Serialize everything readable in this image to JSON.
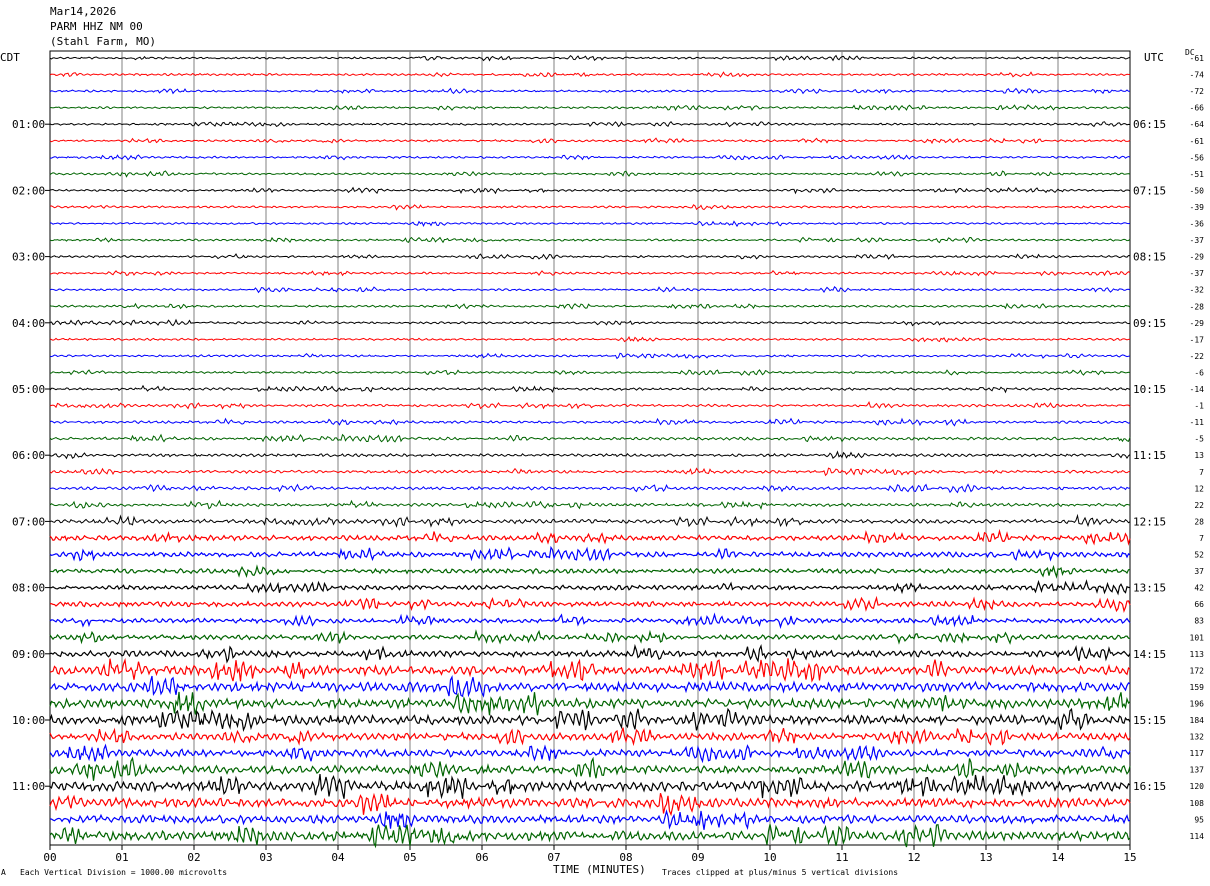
{
  "header": {
    "date": "Mar14,2026",
    "station": "PARM HHZ NM 00",
    "location": "(Stahl Farm, MO)"
  },
  "labels": {
    "left_tz": "CDT",
    "right_tz": "UTC",
    "dc": "DC"
  },
  "footer": {
    "scale_note": "Each Vertical Division = 1000.00 microvolts",
    "clip_note": "Traces clipped at plus/minus 5 vertical divisions",
    "scale_icon": "A"
  },
  "colors": {
    "traces": [
      "#000000",
      "#ff0000",
      "#0000ff",
      "#006400"
    ],
    "grid": "#808080"
  },
  "chart_data": {
    "type": "line",
    "title": "",
    "xlabel": "TIME (MINUTES)",
    "ylabel": "",
    "xlim": [
      0,
      15
    ],
    "x_ticks": [
      "00",
      "01",
      "02",
      "03",
      "04",
      "05",
      "06",
      "07",
      "08",
      "09",
      "10",
      "11",
      "12",
      "13",
      "14",
      "15"
    ],
    "row_count": 48,
    "left_hour_labels": [
      "01:00",
      "02:00",
      "03:00",
      "04:00",
      "05:00",
      "06:00",
      "07:00",
      "08:00",
      "09:00",
      "10:00",
      "11:00"
    ],
    "right_hour_labels": [
      "06:15",
      "07:15",
      "08:15",
      "09:15",
      "10:15",
      "11:15",
      "12:15",
      "13:15",
      "14:15",
      "15:15",
      "16:15"
    ],
    "dc_offsets": [
      "-61",
      "-74",
      "-72",
      "-66",
      "-64",
      "-61",
      "-56",
      "-51",
      "-50",
      "-39",
      "-36",
      "-37",
      "-29",
      "-37",
      "-32",
      "-28",
      "-29",
      "-17",
      "-22",
      "-6",
      "-14",
      "-1",
      "-11",
      "-5",
      "13",
      "7",
      "12",
      "22",
      "28",
      "7",
      "52",
      "37",
      "42",
      "66",
      "83",
      "101",
      "113",
      "172",
      "159",
      "196",
      "184",
      "132",
      "117",
      "137",
      "120",
      "108",
      "95",
      "114"
    ],
    "trace_amplitude": [
      1,
      1,
      1,
      1,
      1,
      1,
      1,
      1,
      1,
      1,
      1,
      1,
      1,
      1,
      1,
      1,
      1,
      1,
      1,
      1,
      1.2,
      1.2,
      1.3,
      1.4,
      1.4,
      1.4,
      1.5,
      1.5,
      2,
      2.5,
      2.5,
      2.2,
      2.2,
      2.5,
      2.2,
      2.3,
      3,
      4.5,
      4.5,
      4.5,
      4.5,
      3.5,
      3.5,
      4,
      4.5,
      4.5,
      4,
      4.5
    ]
  }
}
